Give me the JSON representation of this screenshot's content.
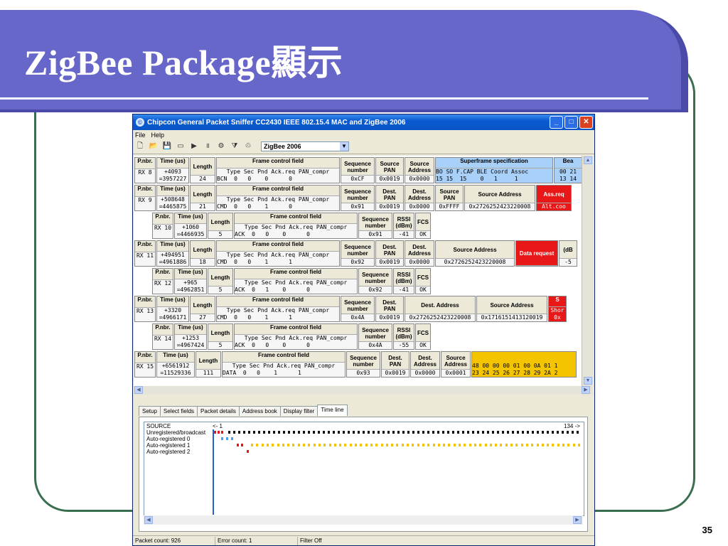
{
  "slide": {
    "title": "ZigBee Package顯示",
    "page_number": "35"
  },
  "window": {
    "title": "Chipcon General Packet Sniffer CC2430 IEEE 802.15.4 MAC and ZigBee 2006",
    "menu": [
      "File",
      "Help"
    ],
    "protocol": "ZigBee 2006"
  },
  "labels": {
    "pnbr": "P.nbr.",
    "time": "Time (us)",
    "length": "Length",
    "fcf": "Frame control field",
    "fcf_cols": "Type Sec Pnd Ack.req PAN_compr",
    "seq": "Sequence number",
    "src_pan": "Source PAN",
    "src_addr": "Source Address",
    "dest_pan": "Dest. PAN",
    "dest_addr": "Dest. Address",
    "dest_address": "Dest. Address",
    "rssi": "RSSI (dBm)",
    "fcs": "FCS",
    "superframe": "Superframe specification",
    "sf_cols": "BO SO F.CAP BLE Coord Assoc",
    "beacon": "Bea",
    "rs": "RS",
    "rs_sub": "(dB",
    "red_s": "S"
  },
  "packets": [
    {
      "nbr": "RX 8",
      "time1": "+4093",
      "time2": "=3957227",
      "length": "24",
      "fcf": "BCN  0   0    0      0",
      "seq": "0xCF",
      "src_pan": "0x0019",
      "src_addr": "0x0000",
      "sf": "15 15  15    0   1     1",
      "beacon_v1": "00 21",
      "beacon_v2": "13 14"
    },
    {
      "nbr": "RX 9",
      "time1": "+508648",
      "time2": "=4465875",
      "length": "21",
      "fcf": "CMD  0   0    1      0",
      "seq": "0x91",
      "dest_pan": "0x0019",
      "dest_addr": "0x0000",
      "src_pan": "0xFFFF",
      "src_addr": "0x2726252423220008",
      "red": "Ass.req",
      "red_v": "Alt.coo"
    },
    {
      "nbr": "RX 10",
      "time1": "+1060",
      "time2": "=4466935",
      "length": "5",
      "fcf": "ACK  0   0    0      0",
      "seq": "0x91",
      "rssi": "-41",
      "fcs": "OK"
    },
    {
      "nbr": "RX 11",
      "time1": "+494951",
      "time2": "=4961886",
      "length": "18",
      "fcf": "CMD  0   0    1      1",
      "seq": "0x92",
      "dest_pan": "0x0019",
      "dest_addr": "0x0000",
      "src_addr": "0x2726252423220008",
      "red": "Data request",
      "rssi": "-5"
    },
    {
      "nbr": "RX 12",
      "time1": "+965",
      "time2": "=4962851",
      "length": "5",
      "fcf": "ACK  0   1    0      0",
      "seq": "0x92",
      "rssi": "-41",
      "fcs": "OK"
    },
    {
      "nbr": "RX 13",
      "time1": "+3320",
      "time2": "=4966171",
      "length": "27",
      "fcf": "CMD  0   0    1      1",
      "seq": "0x4A",
      "dest_pan": "0x0019",
      "dest_addr": "0x2726252423220008",
      "src_addr": "0x1716151413120019",
      "red_v1": "Shor",
      "red_v2": "0x"
    },
    {
      "nbr": "RX 14",
      "time1": "+1253",
      "time2": "=4967424",
      "length": "5",
      "fcf": "ACK  0   0    0      0",
      "seq": "0x4A",
      "rssi": "-55",
      "fcs": "OK"
    },
    {
      "nbr": "RX 15",
      "time1": "+6561912",
      "time2": "=11529336",
      "length": "111",
      "fcf": "DATA  0   0    1      1",
      "seq": "0x93",
      "dest_pan": "0x0019",
      "dest_addr": "0x0000",
      "src_addr": "0x0001",
      "payload1": "48 00 00 00 01 00 0A 01 1",
      "payload2": "23 24 25 26 27 28 29 2A 2"
    }
  ],
  "tabs": [
    "Setup",
    "Select fields",
    "Packet details",
    "Address book",
    "Display filter",
    "Time line"
  ],
  "timeline": {
    "header": "SOURCE",
    "start": "<- 1",
    "end": "134 ->",
    "rows": [
      "Unregistered/broadcast",
      "Auto-registered 0",
      "Auto-registered 1",
      "Auto-registered 2"
    ]
  },
  "status": {
    "packets": "Packet count: 926",
    "errors": "Error count: 1",
    "filter": "Filter Off"
  },
  "colors": {
    "title_bg": "#6766c9",
    "frame": "#3a6e50",
    "blue_cell": "#a8d0f8",
    "red_cell": "#e81818",
    "yellow_cell": "#f5c400",
    "event_red": "#e81818",
    "event_blue": "#4aa0f0",
    "event_yellow": "#f5c400",
    "event_black": "#111111"
  },
  "icons": [
    "new-icon",
    "open-icon",
    "save-icon",
    "clear-icon",
    "play-icon",
    "pause-icon",
    "settings-icon",
    "filter-icon",
    "hex-icon"
  ]
}
